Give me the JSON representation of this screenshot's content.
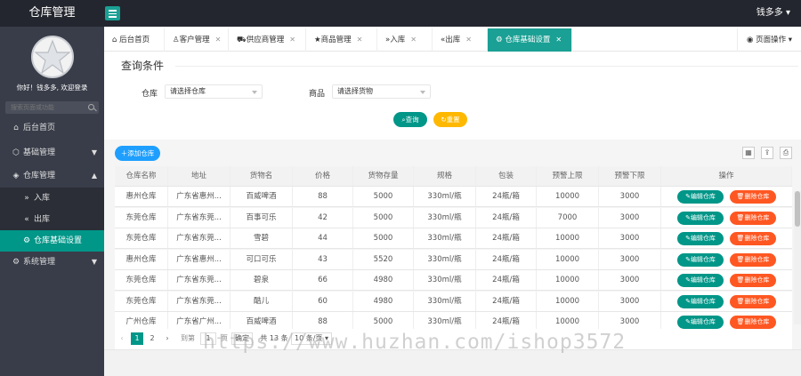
{
  "app": {
    "title": "仓库管理",
    "user": "钱多多"
  },
  "sidebar": {
    "greeting": "你好！钱多多, 欢迎登录",
    "search_placeholder": "搜索页面或功能",
    "items": [
      {
        "label": "后台首页",
        "icon": "home-icon"
      },
      {
        "label": "基础管理",
        "icon": "cube-icon"
      },
      {
        "label": "仓库管理",
        "icon": "compass-icon"
      },
      {
        "label": "入库",
        "icon": "double-right-icon"
      },
      {
        "label": "出库",
        "icon": "double-left-icon"
      },
      {
        "label": "仓库基础设置",
        "icon": "gear-icon"
      },
      {
        "label": "系统管理",
        "icon": "gear-icon"
      }
    ]
  },
  "tabs": [
    {
      "label": "后台首页",
      "icon": "home-icon"
    },
    {
      "label": "客户管理",
      "icon": "user-icon"
    },
    {
      "label": "供应商管理",
      "icon": "cart-icon"
    },
    {
      "label": "商品管理",
      "icon": "star-icon"
    },
    {
      "label": "入库",
      "icon": "double-right-icon"
    },
    {
      "label": "出库",
      "icon": "double-left-icon"
    },
    {
      "label": "仓库基础设置",
      "icon": "gear-icon"
    }
  ],
  "page_ops": "页面操作",
  "query": {
    "title": "查询条件",
    "warehouse_label": "仓库",
    "warehouse_placeholder": "请选择仓库",
    "goods_label": "商品",
    "goods_placeholder": "请选择货物",
    "search_btn": "查询",
    "reset_btn": "重置"
  },
  "toolbar": {
    "add_btn": "添加仓库"
  },
  "table": {
    "columns": [
      "仓库名称",
      "地址",
      "货物名",
      "价格",
      "货物存量",
      "规格",
      "包装",
      "预警上限",
      "预警下限",
      "操作"
    ],
    "edit_label": "编辑仓库",
    "delete_label": "删除仓库",
    "rows": [
      [
        "惠州仓库",
        "广东省惠州...",
        "百威啤酒",
        "88",
        "5000",
        "330ml/瓶",
        "24瓶/箱",
        "10000",
        "3000"
      ],
      [
        "东莞仓库",
        "广东省东莞...",
        "百事可乐",
        "42",
        "5000",
        "330ml/瓶",
        "24瓶/箱",
        "7000",
        "3000"
      ],
      [
        "东莞仓库",
        "广东省东莞...",
        "雪碧",
        "44",
        "5000",
        "330ml/瓶",
        "24瓶/箱",
        "10000",
        "3000"
      ],
      [
        "惠州仓库",
        "广东省惠州...",
        "可口可乐",
        "43",
        "5520",
        "330ml/瓶",
        "24瓶/箱",
        "10000",
        "3000"
      ],
      [
        "东莞仓库",
        "广东省东莞...",
        "碧泉",
        "66",
        "4980",
        "330ml/瓶",
        "24瓶/箱",
        "10000",
        "3000"
      ],
      [
        "东莞仓库",
        "广东省东莞...",
        "酷儿",
        "60",
        "4980",
        "330ml/瓶",
        "24瓶/箱",
        "10000",
        "3000"
      ],
      [
        "广州仓库",
        "广东省广州...",
        "百威啤酒",
        "88",
        "5000",
        "330ml/瓶",
        "24瓶/箱",
        "10000",
        "3000"
      ]
    ]
  },
  "pager": {
    "pages": [
      "1",
      "2"
    ],
    "goto_label": "到第",
    "goto_value": "1",
    "page_unit": "页",
    "confirm": "确定",
    "total": "共 13 条",
    "per_page": "10 条/页"
  },
  "watermark": "https://www.huzhan.com/ishop3572"
}
